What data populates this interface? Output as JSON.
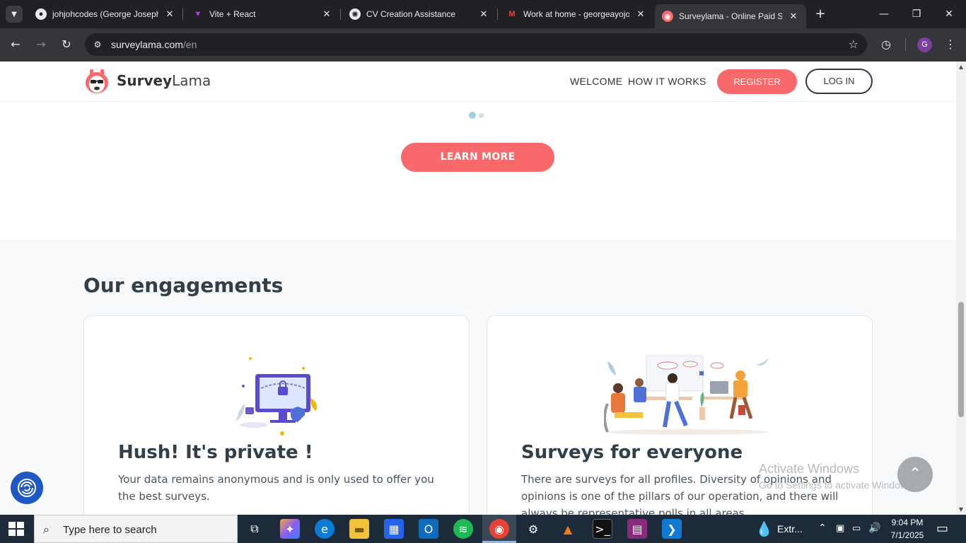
{
  "browser": {
    "tabs": [
      {
        "title": "johjohcodes (George Joseph",
        "favicon": "github-icon",
        "active": false
      },
      {
        "title": "Vite + React",
        "favicon": "vite-icon",
        "active": false
      },
      {
        "title": "CV Creation Assistance",
        "favicon": "openai-icon",
        "active": false
      },
      {
        "title": "Work at home - georgeayojo",
        "favicon": "gmail-icon",
        "active": false
      },
      {
        "title": "Surveylama - Online Paid Su",
        "favicon": "surveylama-icon",
        "active": true
      }
    ],
    "url_host": "surveylama.com",
    "url_path": "/en",
    "profile_initial": "G"
  },
  "site": {
    "logo_bold": "Survey",
    "logo_light": "Lama",
    "nav": {
      "welcome": "WELCOME",
      "how_it_works": "HOW IT WORKS",
      "register": "REGISTER",
      "login": "LOG IN"
    },
    "carousel": {
      "slides": 2,
      "active_index": 0
    },
    "learn_more": "LEARN MORE",
    "engagements": {
      "title": "Our engagements",
      "cards": [
        {
          "title": "Hush! It's private !",
          "text": "Your data remains anonymous and is only used to offer you the best surveys."
        },
        {
          "title": "Surveys for everyone",
          "text": "There are surveys for all profiles. Diversity of opinions and opinions is one of the pillars of our operation, and there will always be representative polls in all areas."
        }
      ]
    }
  },
  "watermark": {
    "line1": "Activate Windows",
    "line2": "Go to Settings to activate Windows."
  },
  "taskbar": {
    "search_placeholder": "Type here to search",
    "weather_text": "Extr...",
    "time": "9:04 PM",
    "date": "7/1/2025"
  },
  "colors": {
    "accent": "#f8696b",
    "dark": "#2f3a45",
    "carousel_dot": "#9cd3e0"
  }
}
